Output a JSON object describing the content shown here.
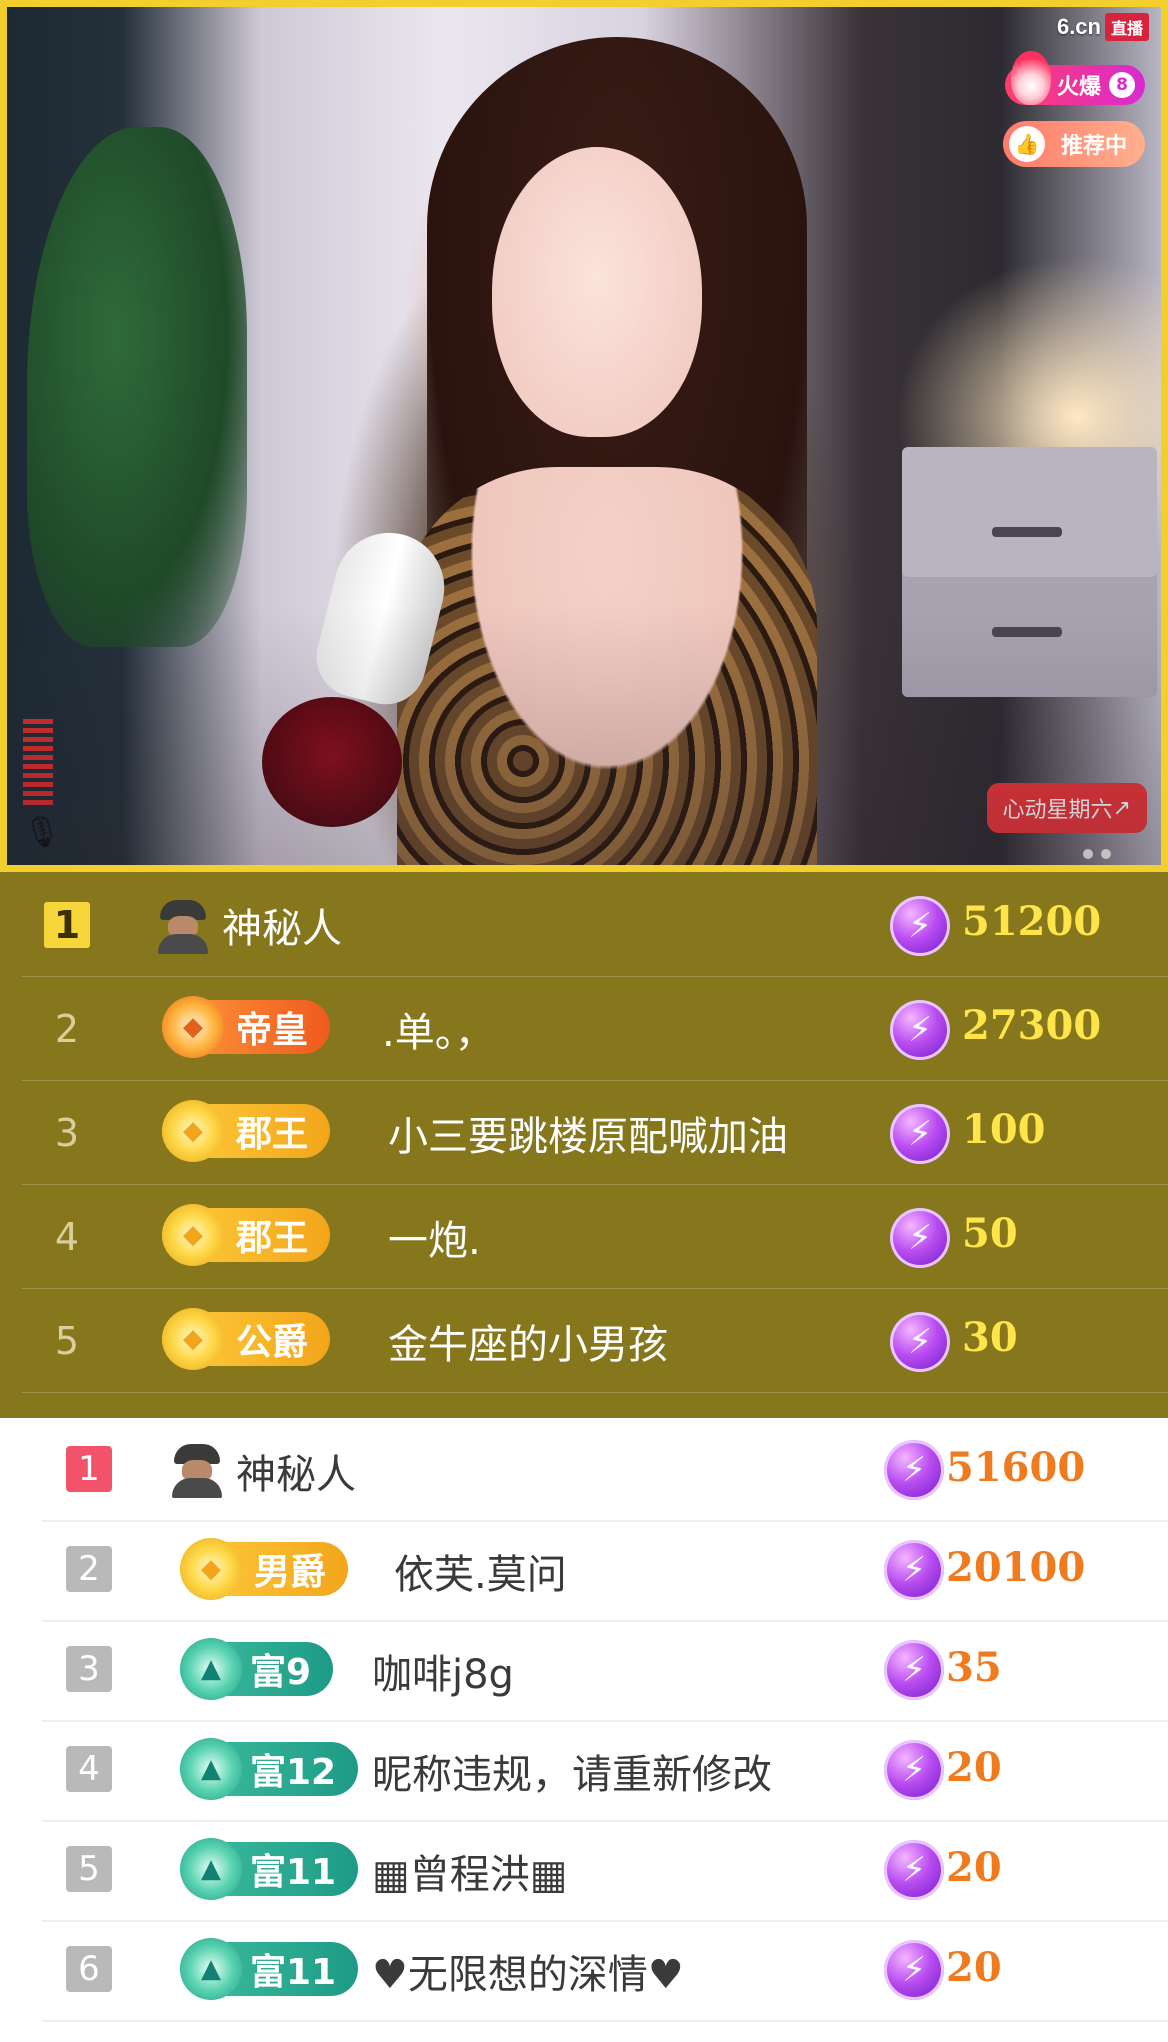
{
  "stream": {
    "logo_text": "6.cn",
    "live_label": "直播",
    "hot_label": "火爆",
    "hot_rank": "8",
    "recommend_label": "推荐中",
    "event_label": "心动星期六"
  },
  "gold_ranking": [
    {
      "rank": "1",
      "badge": null,
      "name": "神秘人",
      "score": "51200"
    },
    {
      "rank": "2",
      "badge": "帝皇",
      "badge_color": "orange",
      "name": ".单。，",
      "score": "27300"
    },
    {
      "rank": "3",
      "badge": "郡王",
      "badge_color": "yellow",
      "name": "小三要跳楼原配喊加油",
      "score": "100"
    },
    {
      "rank": "4",
      "badge": "郡王",
      "badge_color": "yellow",
      "name": "一炮.",
      "score": "50"
    },
    {
      "rank": "5",
      "badge": "公爵",
      "badge_color": "yellow",
      "name": "金牛座的小男孩",
      "score": "30"
    }
  ],
  "white_ranking": [
    {
      "rank": "1",
      "badge": null,
      "name": "神秘人",
      "score": "51600"
    },
    {
      "rank": "2",
      "badge": "男爵",
      "badge_color": "yellow",
      "name": "依芙.莫问",
      "score": "20100"
    },
    {
      "rank": "3",
      "badge": "富9",
      "badge_color": "teal",
      "name": "咖啡j8g",
      "score": "35"
    },
    {
      "rank": "4",
      "badge": "富12",
      "badge_color": "teal",
      "name": "昵称违规，请重新修改",
      "score": "20"
    },
    {
      "rank": "5",
      "badge": "富11",
      "badge_color": "teal",
      "name": "▦曾程洪▦",
      "score": "20"
    },
    {
      "rank": "6",
      "badge": "富11",
      "badge_color": "teal",
      "name": "♥无限想的深情♥",
      "score": "20"
    }
  ],
  "icons": {
    "currency": "lightning-gem-icon",
    "anonymous": "mystery-person-icon",
    "mic": "microphone-icon"
  }
}
